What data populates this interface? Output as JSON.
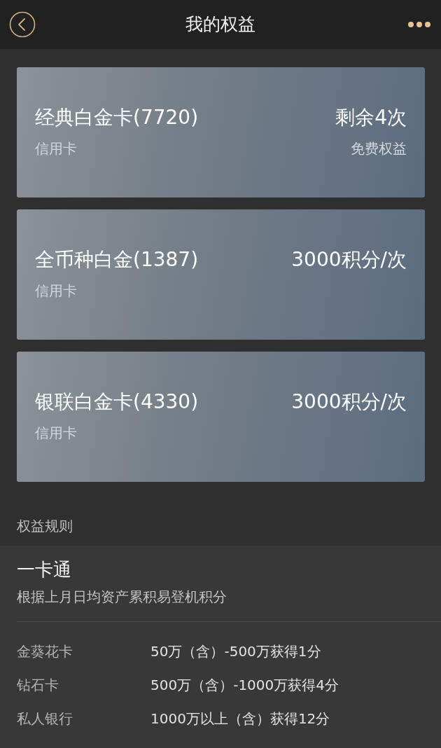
{
  "header": {
    "title": "我的权益"
  },
  "cards": [
    {
      "name": "经典白金卡(7720)",
      "type": "信用卡",
      "benefit": "剩余4次",
      "benefit_note": "免费权益"
    },
    {
      "name": "全币种白金(1387)",
      "type": "信用卡",
      "benefit": "3000积分/次"
    },
    {
      "name": "银联白金卡(4330)",
      "type": "信用卡",
      "benefit": "3000积分/次"
    }
  ],
  "rules": {
    "heading": "权益规则",
    "title": "一卡通",
    "description": "根据上月日均资产累积易登机积分",
    "tiers": [
      {
        "card": "金葵花卡",
        "rule": "50万（含）-500万获得1分"
      },
      {
        "card": "钻石卡",
        "rule": "500万（含）-1000万获得4分"
      },
      {
        "card": "私人银行",
        "rule": "1000万以上（含）获得12分"
      }
    ]
  }
}
